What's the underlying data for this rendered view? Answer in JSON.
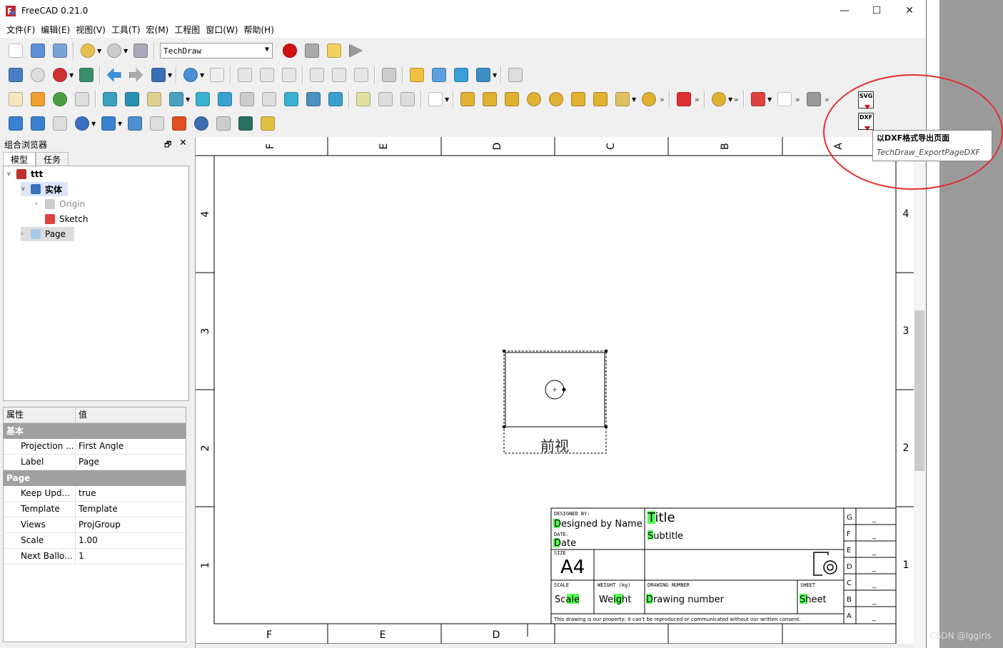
{
  "window": {
    "title": "FreeCAD 0.21.0",
    "minimize": "—",
    "maximize": "☐",
    "close": "✕"
  },
  "menu": [
    "文件(F)",
    "编辑(E)",
    "视图(V)",
    "工具(T)",
    "宏(M)",
    "工程图",
    "窗口(W)",
    "帮助(H)"
  ],
  "toolbar": {
    "workbench": "TechDraw"
  },
  "combo_view": {
    "title": "组合浏览器",
    "tabs": [
      "模型",
      "任务"
    ]
  },
  "tree": [
    {
      "label": "ttt",
      "bold": true
    },
    {
      "label": "实体",
      "bold": true,
      "selected": true
    },
    {
      "label": "Origin",
      "dim": true
    },
    {
      "label": "Sketch"
    },
    {
      "label": "Page",
      "selected": true
    }
  ],
  "properties": {
    "header_key": "属性",
    "header_value": "值",
    "groups": [
      {
        "name": "基本",
        "rows": [
          {
            "k": "Projection ...",
            "v": "First Angle"
          },
          {
            "k": "Label",
            "v": "Page"
          }
        ]
      },
      {
        "name": "Page",
        "rows": [
          {
            "k": "Keep Upd...",
            "v": "true"
          },
          {
            "k": "Template",
            "v": "Template"
          },
          {
            "k": "Views",
            "v": "ProjGroup"
          },
          {
            "k": "Scale",
            "v": "1.00"
          },
          {
            "k": "Next Ballo...",
            "v": "1"
          }
        ]
      }
    ]
  },
  "drawing": {
    "columns_top": [
      "F",
      "E",
      "D",
      "C",
      "B",
      "A"
    ],
    "columns_bottom": [
      "F",
      "E",
      "D"
    ],
    "rows_left": [
      "4",
      "3",
      "2",
      "1"
    ],
    "rows_right": [
      "4",
      "3",
      "2",
      "1"
    ],
    "view_label": "前视",
    "title_block": {
      "designed_by_label": "DESIGNED BY:",
      "designed_by": "Designed by Name",
      "date_label": "DATE:",
      "date": "Date",
      "title": "Title",
      "subtitle": "Subtitle",
      "size_label": "SIZE",
      "size": "A4",
      "scale_label": "SCALE",
      "scale": "Scale",
      "weight_label": "WEIGHT (kg)",
      "weight": "Weight",
      "drawing_number_label": "DRAWING NUMBER",
      "drawing_number": "Drawing number",
      "sheet_label": "SHEET",
      "sheet": "Sheet",
      "disclaimer": "This drawing is our property; it can't be reproduced or communicated without our written consent.",
      "revisions": [
        "G",
        "F",
        "E",
        "D",
        "C",
        "B",
        "A"
      ],
      "rev_value": "_"
    }
  },
  "popup": {
    "svg": "SVG",
    "dxf": "DXF"
  },
  "tooltip": {
    "title": "以DXF格式导出页面",
    "command": "TechDraw_ExportPageDXF"
  },
  "watermark": "CSDN @lggirls",
  "colors": {
    "highlight": "#55ff55",
    "annotation": "#e03030"
  }
}
